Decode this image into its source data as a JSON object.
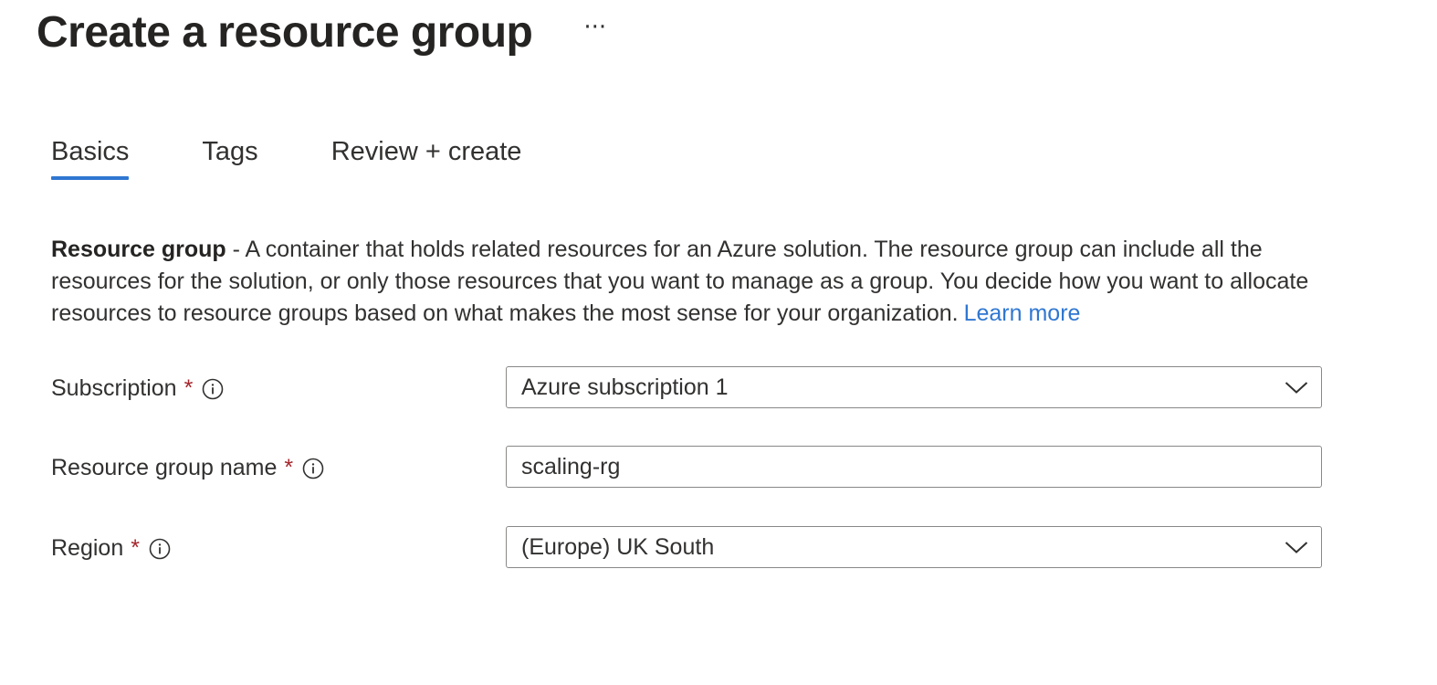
{
  "header": {
    "title": "Create a resource group",
    "more_label": "···"
  },
  "tabs": [
    {
      "label": "Basics",
      "selected": true
    },
    {
      "label": "Tags",
      "selected": false
    },
    {
      "label": "Review + create",
      "selected": false
    }
  ],
  "description": {
    "bold": "Resource group",
    "text": " - A container that holds related resources for an Azure solution. The resource group can include all the resources for the solution, or only those resources that you want to manage as a group. You decide how you want to allocate resources to resource groups based on what makes the most sense for your organization.",
    "link": "Learn more"
  },
  "form": {
    "subscription": {
      "label": "Subscription",
      "required_mark": "*",
      "value": "Azure subscription 1"
    },
    "resource_group_name": {
      "label": "Resource group name",
      "required_mark": "*",
      "value": "scaling-rg"
    },
    "region": {
      "label": "Region",
      "required_mark": "*",
      "value": "(Europe) UK South"
    }
  },
  "icons": {
    "info": "info-icon",
    "dropdown": "chevron-down-icon",
    "more": "more-icon"
  },
  "colors": {
    "accent": "#2f77d1",
    "required": "#a4262c",
    "border": "#8a8886",
    "text": "#323130"
  }
}
